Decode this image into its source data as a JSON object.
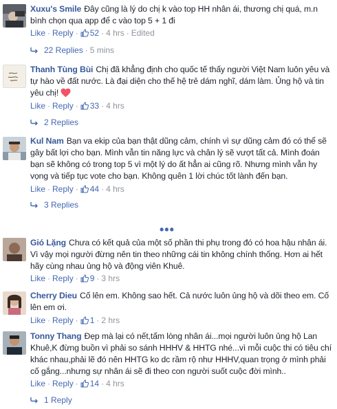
{
  "comments": [
    {
      "name": "Xuxu's Smile",
      "text": "Đây cũng là lý do chị k vào top HH nhân ái, thương chị quá, m.n bình chọn qua app để c vào top 5 + 1 đi",
      "like": "Like",
      "reply": "Reply",
      "likes": "52",
      "time": "4 hrs",
      "edited": "Edited"
    },
    {
      "name": "Thanh Tùng Bùi",
      "text": "Chị đã khẳng định cho quốc tế thấy người Việt Nam luôn yêu và tự hào về đất nước. Là đại diện cho thế hệ trẻ dám nghĩ, dám làm. Ủng hộ và tin yêu chị!",
      "like": "Like",
      "reply": "Reply",
      "likes": "33",
      "time": "4 hrs"
    },
    {
      "name": "Kul Nam",
      "text": "Bạn va ekip của bạn thật dũng cảm, chính vì sự dũng cảm đó có thể sẽ gây bất lợi cho bạn. Mình vẫn tin năng lực và chân lý sẽ vượt tất cả. Mình đoán bạn sẽ không có trong top 5 vì một lý do ất hẳn ai cũng rõ. Nhưng mình vẫn hy vọng và tiếp tục vote cho bạn. Không quên 1 lời chúc tốt lành đến bạn.",
      "like": "Like",
      "reply": "Reply",
      "likes": "44",
      "time": "4 hrs"
    },
    {
      "name": "Gió Lặng",
      "text": "Chưa có kết quả của một số phần thi phụ trong đó có hoa hậu nhân ái. Vì vậy mọi người đừng nên tin theo những cái tin không chính thống. Hơn ai hết hãy cùng nhau ủng hộ và động viên Khuê.",
      "like": "Like",
      "reply": "Reply",
      "likes": "9",
      "time": "3 hrs"
    },
    {
      "name": "Cherry Dieu",
      "text": "Cố lên em. Không sao hết. Cả nước luôn ủng hộ và dõi theo em. Cố lên em ơi.",
      "like": "Like",
      "reply": "Reply",
      "likes": "1",
      "time": "2 hrs"
    },
    {
      "name": "Tonny Thang",
      "text": "Đẹp mà lại có nết,tấm lòng nhân ái...mọi người luôn ủng hộ Lan Khuê,K đừng buồn vì phải so sánh HHHV & HHTG nhé...vì mỗi cuộc thi có tiêu chí khác nhau,phải lẽ đó nên HHTG ko dc rầm rộ như HHHV,quan trọng ở mình phải cố gắng...nhưng sự nhân ái sẽ đi theo con người suốt cuộc đời mình..",
      "like": "Like",
      "reply": "Reply",
      "likes": "14",
      "time": "4 hrs"
    }
  ],
  "replies": [
    "22 Replies",
    "2 Replies",
    "3 Replies",
    "1 Reply"
  ],
  "replies_time": "5 mins",
  "more": "•••",
  "colors": {
    "link": "#4267b2",
    "name": "#365899",
    "text": "#1d2129",
    "grey": "#90949c",
    "heart": "#f25268"
  }
}
